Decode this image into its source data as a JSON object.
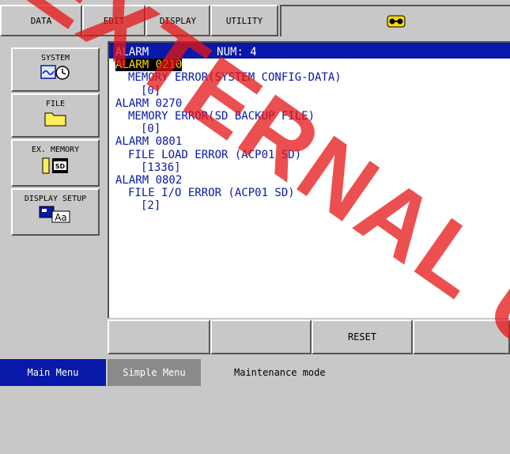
{
  "menubar": {
    "tabs": [
      "DATA",
      "EDIT",
      "DISPLAY",
      "UTILITY"
    ],
    "status_icon": "keys-icon"
  },
  "sidebar": {
    "items": [
      {
        "label": "SYSTEM",
        "icon": "system-clock-icon"
      },
      {
        "label": "FILE",
        "icon": "folder-icon"
      },
      {
        "label": "EX. MEMORY",
        "icon": "sd-card-icon"
      },
      {
        "label": "DISPLAY SETUP",
        "icon": "display-font-icon"
      }
    ]
  },
  "alarm_panel": {
    "title": "ALARM",
    "num_label": "NUM: 4",
    "alarms": [
      {
        "code": "ALARM 0210",
        "message": "MEMORY ERROR(SYSTEM CONFIG-DATA)",
        "sub": "[0]"
      },
      {
        "code": "ALARM 0270",
        "message": "MEMORY ERROR(SD BACKUP FILE)",
        "sub": "[0]"
      },
      {
        "code": "ALARM 0801",
        "message": "FILE LOAD ERROR (ACP01 SD)",
        "sub": "[1336]"
      },
      {
        "code": "ALARM 0802",
        "message": "FILE I/O ERROR (ACP01 SD)",
        "sub": "[2]"
      }
    ]
  },
  "softkeys": [
    "",
    "",
    "RESET",
    ""
  ],
  "bottombar": {
    "main_menu": "Main Menu",
    "simple_menu": "Simple Menu",
    "mode": "Maintenance mode"
  },
  "watermark": "EXTERNAL USE",
  "colors": {
    "header_blue": "#0818a8",
    "highlight_yellow": "#ffd800",
    "watermark_red": "#e61414",
    "background_gray": "#c8c8c8"
  }
}
